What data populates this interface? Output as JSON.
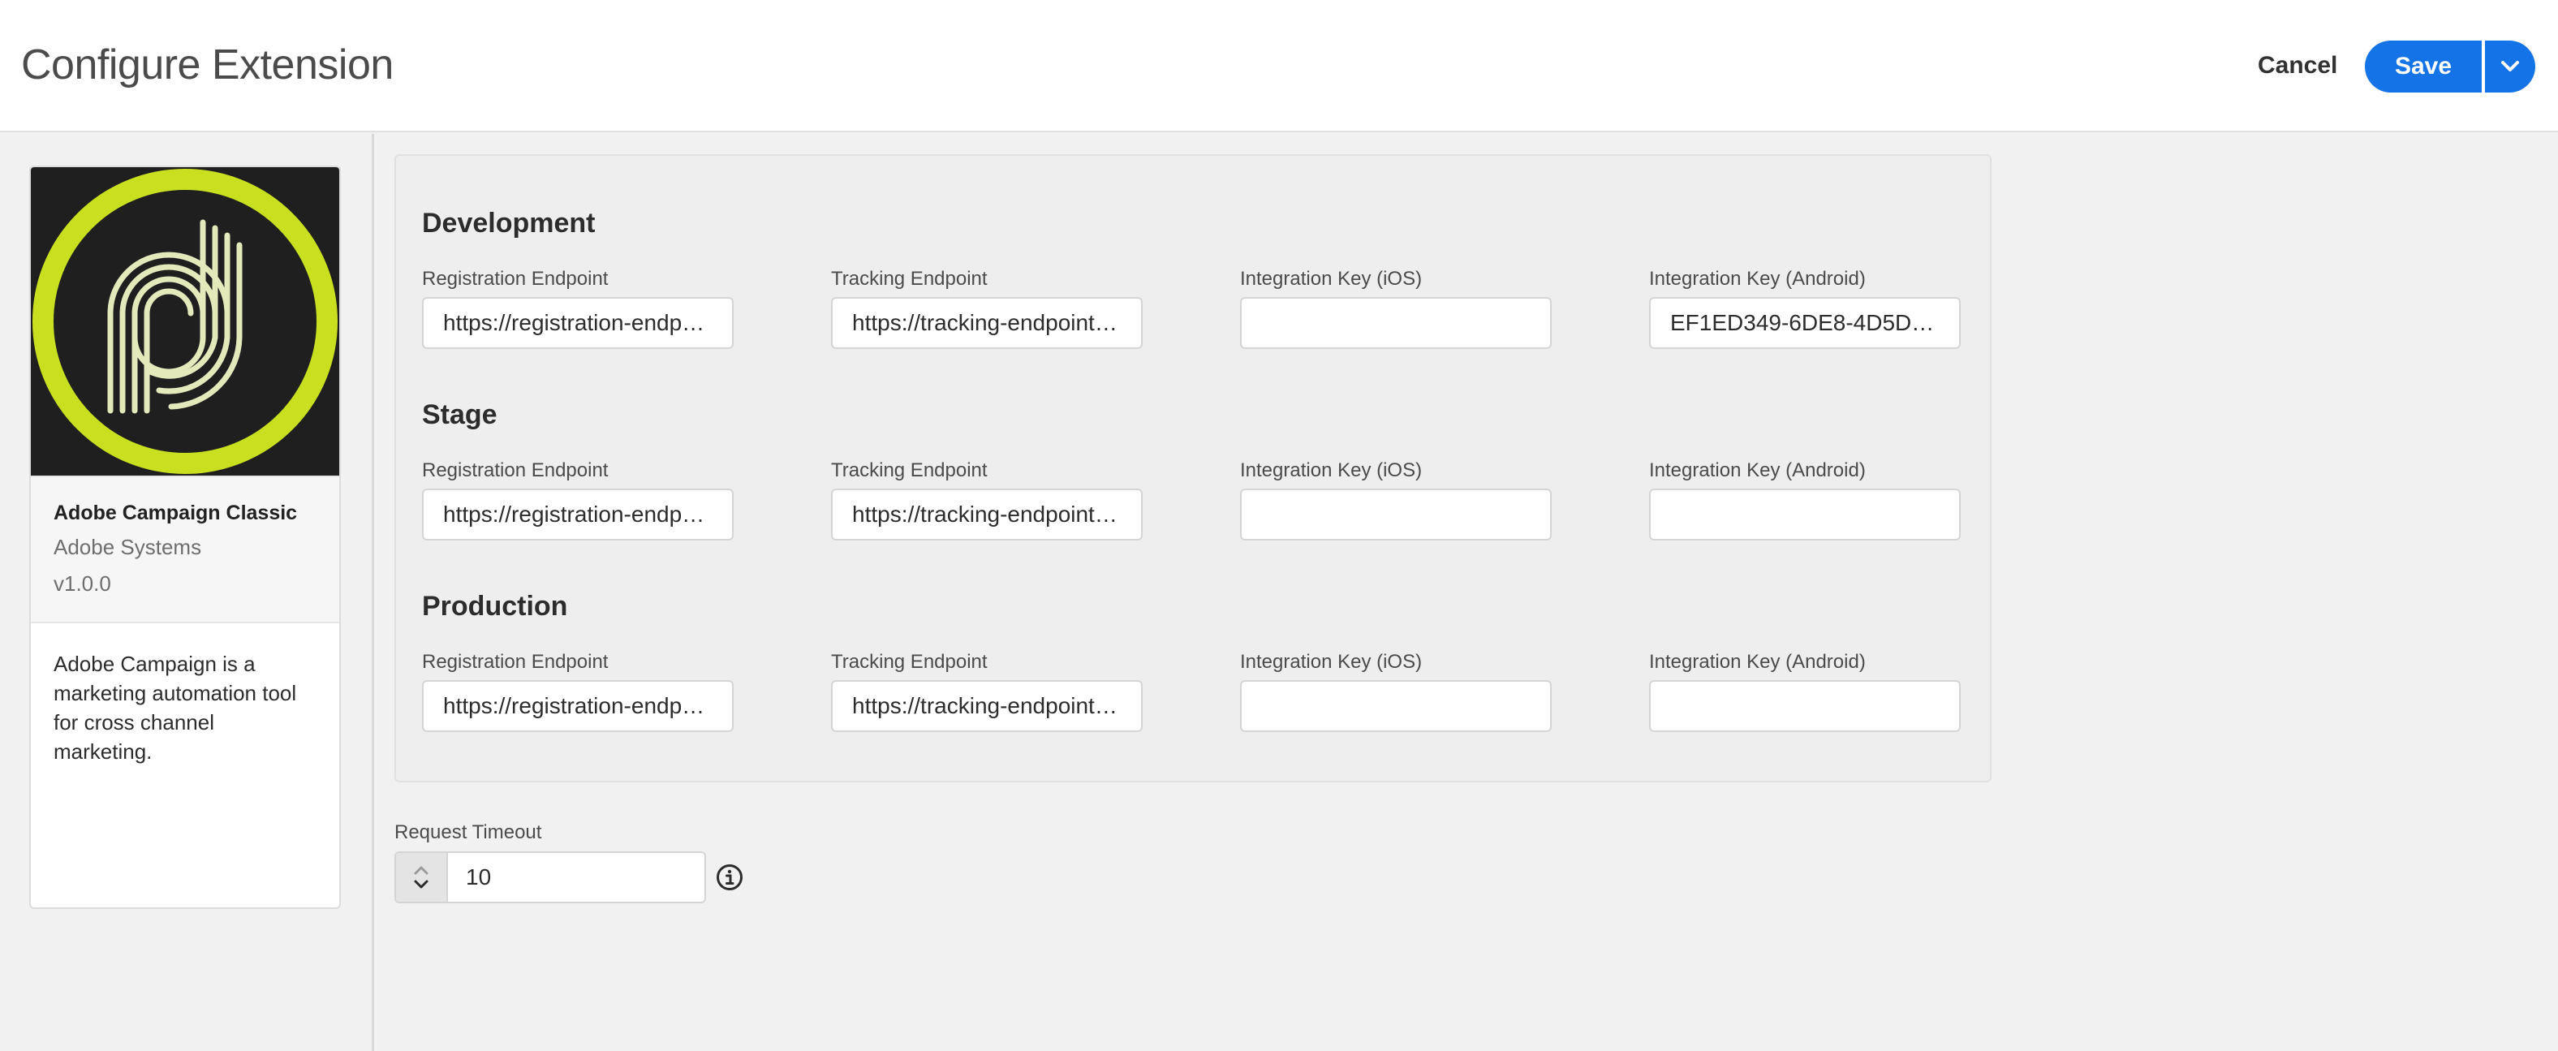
{
  "header": {
    "title": "Configure Extension",
    "cancel_label": "Cancel",
    "save_label": "Save",
    "save_menu_icon": "chevron-down-icon"
  },
  "extension": {
    "logo_icon": "adobe-campaign-logo-icon",
    "name": "Adobe Campaign Classic",
    "vendor": "Adobe Systems",
    "version": "v1.0.0",
    "description": "Adobe Campaign is a marketing automation tool for cross channel marketing."
  },
  "colors": {
    "accent": "#1473e6",
    "logo_ring": "#c8e01f",
    "logo_bg": "#1f1f1f",
    "logo_mark": "#e4e9bc"
  },
  "environments": [
    {
      "title": "Development",
      "fields": [
        {
          "label": "Registration Endpoint",
          "value": "https://registration-endpoi..."
        },
        {
          "label": "Tracking Endpoint",
          "value": "https://tracking-endpoint.c..."
        },
        {
          "label": "Integration Key (iOS)",
          "value": ""
        },
        {
          "label": "Integration Key (Android)",
          "value": "EF1ED349-6DE8-4D5D-A94..."
        }
      ]
    },
    {
      "title": "Stage",
      "fields": [
        {
          "label": "Registration Endpoint",
          "value": "https://registration-endpoi..."
        },
        {
          "label": "Tracking Endpoint",
          "value": "https://tracking-endpoint.c..."
        },
        {
          "label": "Integration Key (iOS)",
          "value": ""
        },
        {
          "label": "Integration Key (Android)",
          "value": ""
        }
      ]
    },
    {
      "title": "Production",
      "fields": [
        {
          "label": "Registration Endpoint",
          "value": "https://registration-endpoi..."
        },
        {
          "label": "Tracking Endpoint",
          "value": "https://tracking-endpoint.c..."
        },
        {
          "label": "Integration Key (iOS)",
          "value": ""
        },
        {
          "label": "Integration Key (Android)",
          "value": ""
        }
      ]
    }
  ],
  "request_timeout": {
    "label": "Request Timeout",
    "value": "10",
    "info_icon": "info-icon"
  }
}
